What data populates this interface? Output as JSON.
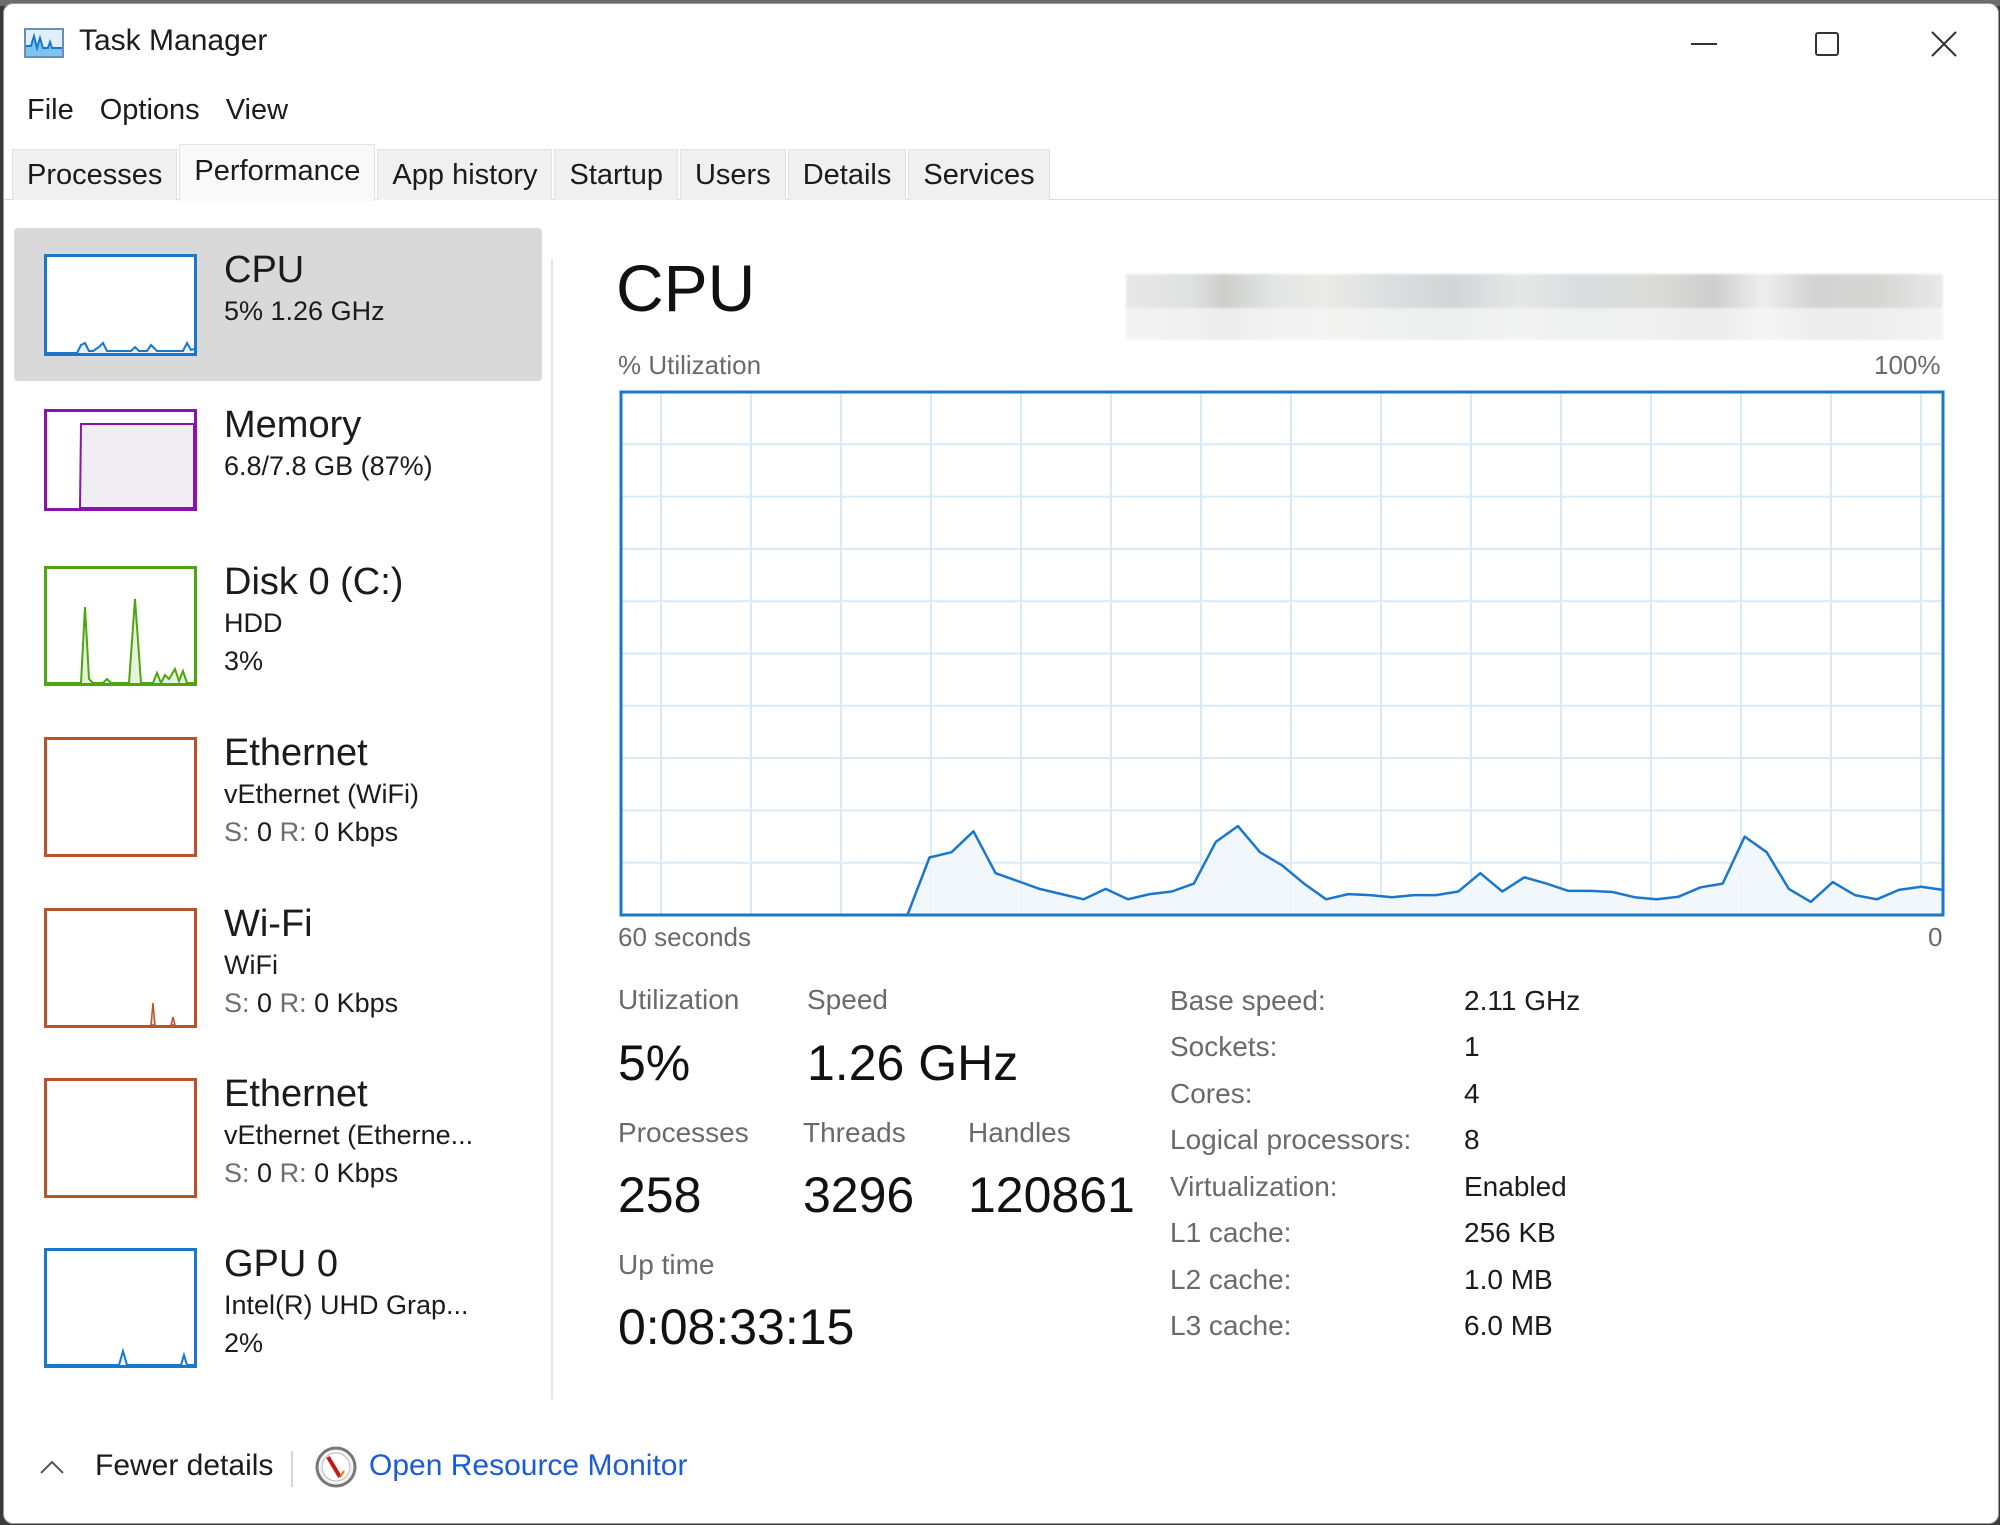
{
  "window": {
    "title": "Task Manager",
    "app_icon": "task-manager-icon",
    "controls": [
      "minimize-icon",
      "maximize-icon",
      "close-icon"
    ]
  },
  "menu": [
    "File",
    "Options",
    "View"
  ],
  "tabs": [
    {
      "label": "Processes",
      "active": false
    },
    {
      "label": "Performance",
      "active": true
    },
    {
      "label": "App history",
      "active": false
    },
    {
      "label": "Startup",
      "active": false
    },
    {
      "label": "Users",
      "active": false
    },
    {
      "label": "Details",
      "active": false
    },
    {
      "label": "Services",
      "active": false
    }
  ],
  "sidebar": {
    "items": [
      {
        "title": "CPU",
        "line1": "5%  1.26 GHz",
        "line2": "",
        "selected": true,
        "color": "#1a77c9"
      },
      {
        "title": "Memory",
        "line1": "6.8/7.8 GB (87%)",
        "line2": "",
        "selected": false,
        "color": "#8b12ae",
        "usage_percent": 87
      },
      {
        "title": "Disk 0 (C:)",
        "line1": "HDD",
        "line2": "3%",
        "selected": false,
        "color": "#4da60c"
      },
      {
        "title": "Ethernet",
        "line1": "vEthernet (WiFi)",
        "send_label": "S:",
        "send": "0",
        "recv_label": "R:",
        "recv": "0 Kbps",
        "selected": false,
        "color": "#b8532b"
      },
      {
        "title": "Wi-Fi",
        "line1": "WiFi",
        "send_label": "S:",
        "send": "0",
        "recv_label": "R:",
        "recv": "0 Kbps",
        "selected": false,
        "color": "#b8532b"
      },
      {
        "title": "Ethernet",
        "line1": "vEthernet (Etherne...",
        "send_label": "S:",
        "send": "0",
        "recv_label": "R:",
        "recv": "0 Kbps",
        "selected": false,
        "color": "#b8532b"
      },
      {
        "title": "GPU 0",
        "line1": "Intel(R) UHD Grap...",
        "line2": "2%",
        "selected": false,
        "color": "#1a77c9"
      }
    ]
  },
  "main": {
    "title": "CPU",
    "util_label": "% Utilization",
    "max_label": "100%",
    "time_left_label": "60 seconds",
    "time_right_label": "0",
    "stats": {
      "utilization_label": "Utilization",
      "utilization": "5%",
      "speed_label": "Speed",
      "speed": "1.26 GHz",
      "processes_label": "Processes",
      "processes": "258",
      "threads_label": "Threads",
      "threads": "3296",
      "handles_label": "Handles",
      "handles": "120861",
      "uptime_label": "Up time",
      "uptime": "0:08:33:15"
    },
    "specs": [
      {
        "label": "Base speed:",
        "value": "2.11 GHz"
      },
      {
        "label": "Sockets:",
        "value": "1"
      },
      {
        "label": "Cores:",
        "value": "4"
      },
      {
        "label": "Logical processors:",
        "value": "8"
      },
      {
        "label": "Virtualization:",
        "value": "Enabled"
      },
      {
        "label": "L1 cache:",
        "value": "256 KB"
      },
      {
        "label": "L2 cache:",
        "value": "1.0 MB"
      },
      {
        "label": "L3 cache:",
        "value": "6.0 MB"
      }
    ]
  },
  "footer": {
    "fewer_details": "Fewer details",
    "resource_monitor": "Open Resource Monitor"
  },
  "colors": {
    "cpu_line": "#1a77c9",
    "cpu_fill": "#f1f6fb",
    "grid": "#d9eaf7",
    "link": "#1a5bd6",
    "selected_bg": "#d9d9d9"
  },
  "chart_data": {
    "type": "area",
    "title": "CPU",
    "ylabel": "% Utilization",
    "xlabel": "60 seconds",
    "x_unit": "seconds ago",
    "x_range": [
      60,
      0
    ],
    "ylim": [
      0,
      100
    ],
    "grid": true,
    "x": [
      60,
      59,
      58,
      57,
      56,
      55,
      54,
      53,
      52,
      51,
      50,
      49,
      48,
      47,
      46,
      45,
      44,
      43,
      42,
      41,
      40,
      39,
      38,
      37,
      36,
      35,
      34,
      33,
      32,
      31,
      30,
      29,
      28,
      27,
      26,
      25,
      24,
      23,
      22,
      21,
      20,
      19,
      18,
      17,
      16,
      15,
      14,
      13,
      12,
      11,
      10,
      9,
      8,
      7,
      6,
      5,
      4,
      3,
      2,
      1,
      0
    ],
    "series": [
      {
        "name": "CPU utilization (%)",
        "values": [
          0,
          0,
          0,
          0,
          0,
          0,
          0,
          0,
          0,
          0,
          0,
          0,
          0,
          0,
          11,
          12,
          16,
          8,
          6.5,
          5,
          4,
          3,
          5,
          3,
          4,
          4.5,
          6,
          14,
          17,
          12,
          9.5,
          6,
          3,
          4,
          3.8,
          3.4,
          3.8,
          3.8,
          4.5,
          8,
          4.5,
          7.2,
          6,
          4.6,
          4.6,
          4.4,
          3.4,
          3,
          3.5,
          5.3,
          6,
          15,
          12,
          5,
          2.5,
          6.3,
          3.8,
          3,
          4.8,
          5.4,
          4.8
        ]
      }
    ]
  }
}
